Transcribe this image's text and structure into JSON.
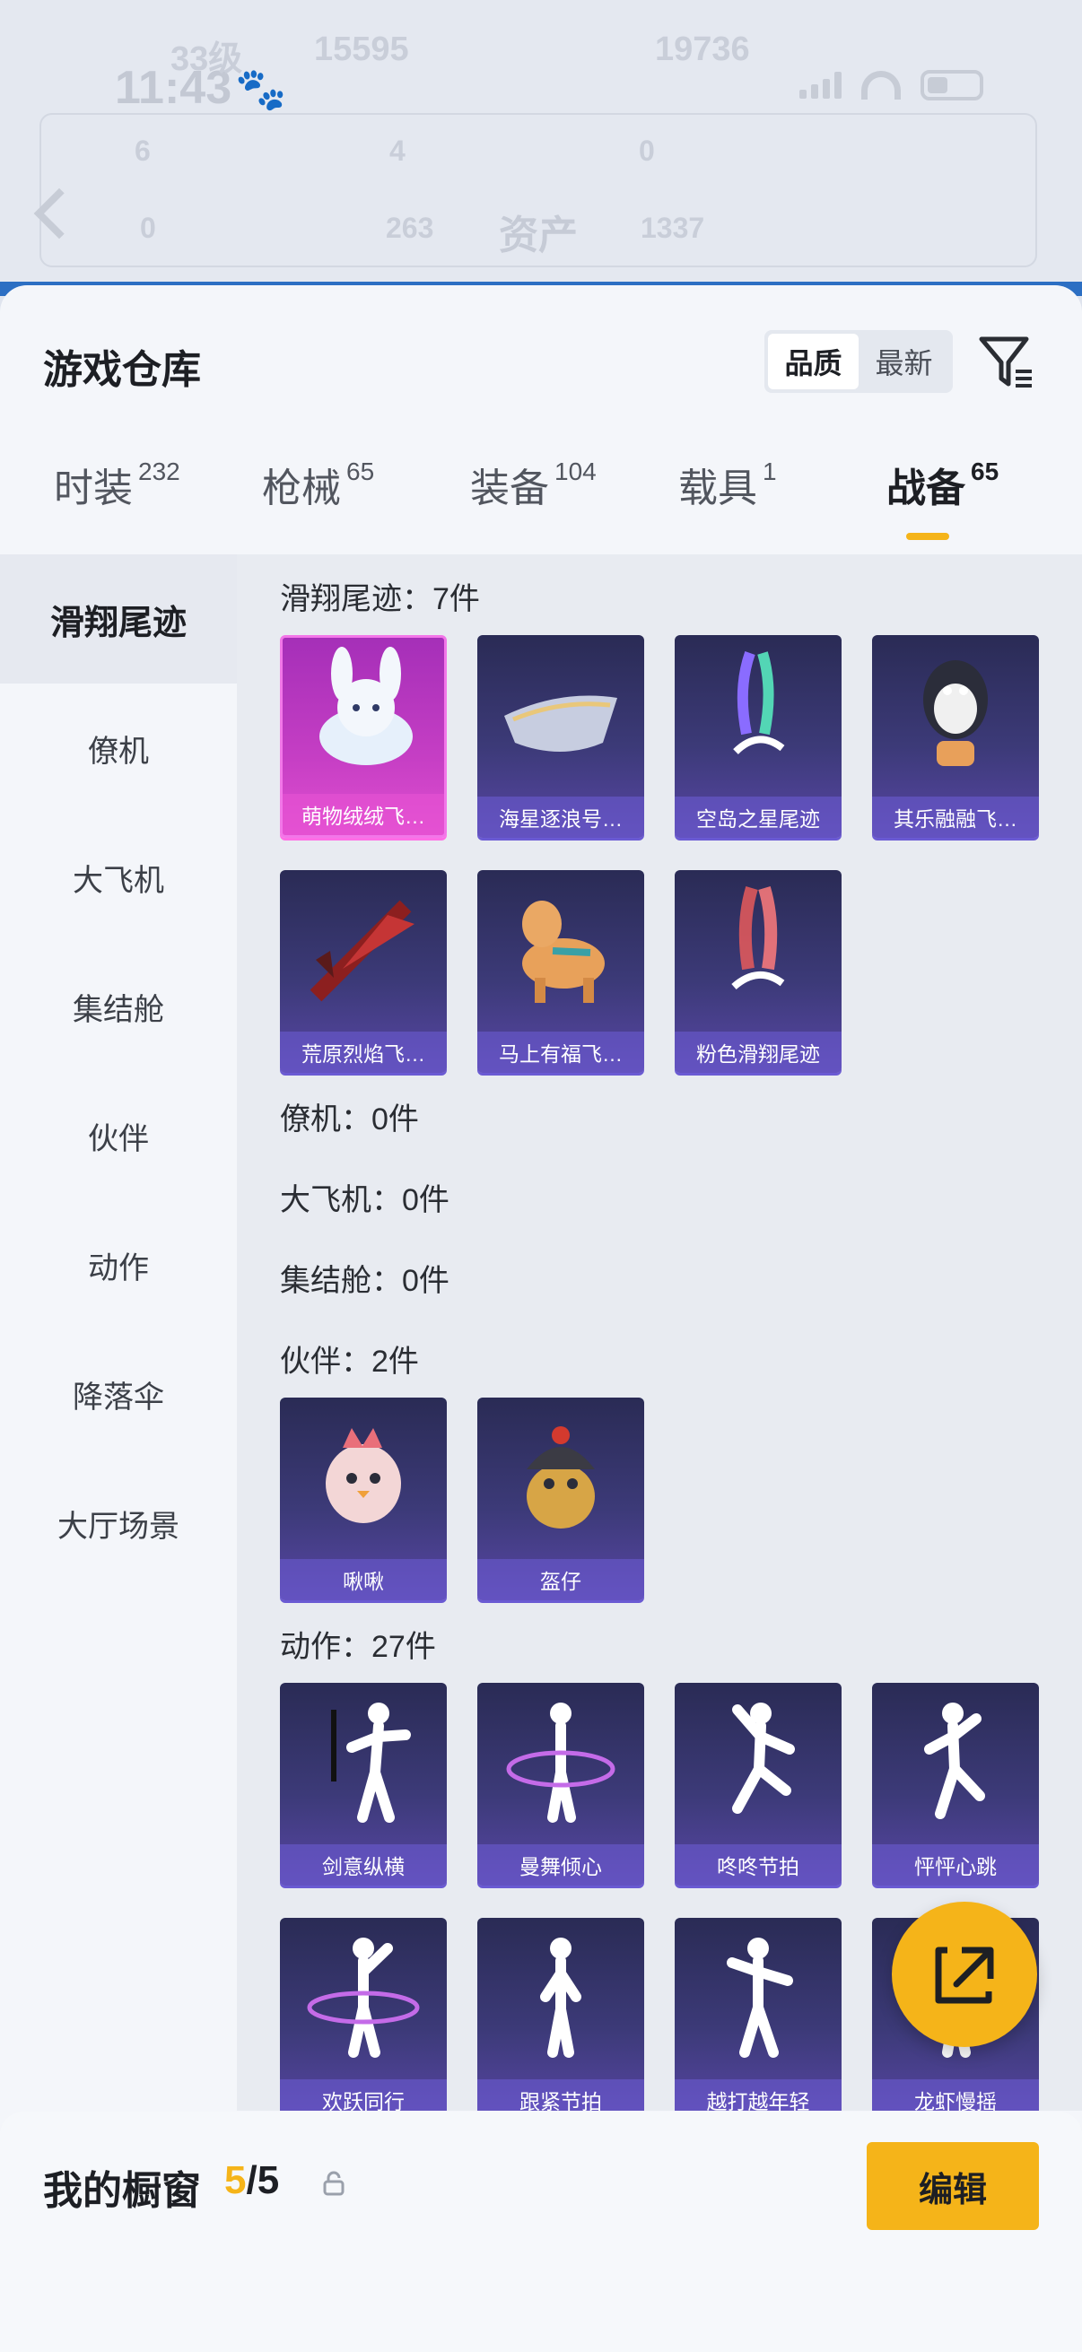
{
  "status_bar": {
    "time": "11:43"
  },
  "background": {
    "title": "资产",
    "faded_texts": [
      "33级",
      "15595",
      "19736",
      "6",
      "4",
      "0",
      "0",
      "263",
      "1337"
    ]
  },
  "header": {
    "title": "游戏仓库",
    "sort_options": [
      "品质",
      "最新"
    ],
    "active_sort": "品质"
  },
  "tabs": [
    {
      "label": "时装",
      "count": "232"
    },
    {
      "label": "枪械",
      "count": "65"
    },
    {
      "label": "装备",
      "count": "104"
    },
    {
      "label": "载具",
      "count": "1"
    },
    {
      "label": "战备",
      "count": "65"
    }
  ],
  "active_tab": "战备",
  "sidebar": {
    "items": [
      "滑翔尾迹",
      "僚机",
      "大飞机",
      "集结舱",
      "伙伴",
      "动作",
      "降落伞",
      "大厅场景"
    ],
    "active": "滑翔尾迹"
  },
  "sections": {
    "glide": {
      "title": "滑翔尾迹：7件",
      "items": [
        "萌物绒绒飞…",
        "海星逐浪号…",
        "空岛之星尾迹",
        "其乐融融飞…",
        "荒原烈焰飞…",
        "马上有福飞…",
        "粉色滑翔尾迹"
      ]
    },
    "wingman": {
      "title": "僚机：0件"
    },
    "bigplane": {
      "title": "大飞机：0件"
    },
    "capsule": {
      "title": "集结舱：0件"
    },
    "partner": {
      "title": "伙伴：2件",
      "items": [
        "啾啾",
        "盔仔"
      ]
    },
    "emote": {
      "title": "动作：27件",
      "items": [
        "剑意纵横",
        "曼舞倾心",
        "咚咚节拍",
        "怦怦心跳",
        "欢跃同行",
        "跟紧节拍",
        "越打越年轻",
        "龙虾慢摇"
      ]
    }
  },
  "bottom_bar": {
    "title": "我的橱窗",
    "count_current": "5",
    "count_separator": "/",
    "count_total": "5",
    "edit_label": "编辑"
  },
  "colors": {
    "accent": "#f5b419",
    "card_purple": "#3c3a78",
    "card_pink": "#c53ec4"
  }
}
